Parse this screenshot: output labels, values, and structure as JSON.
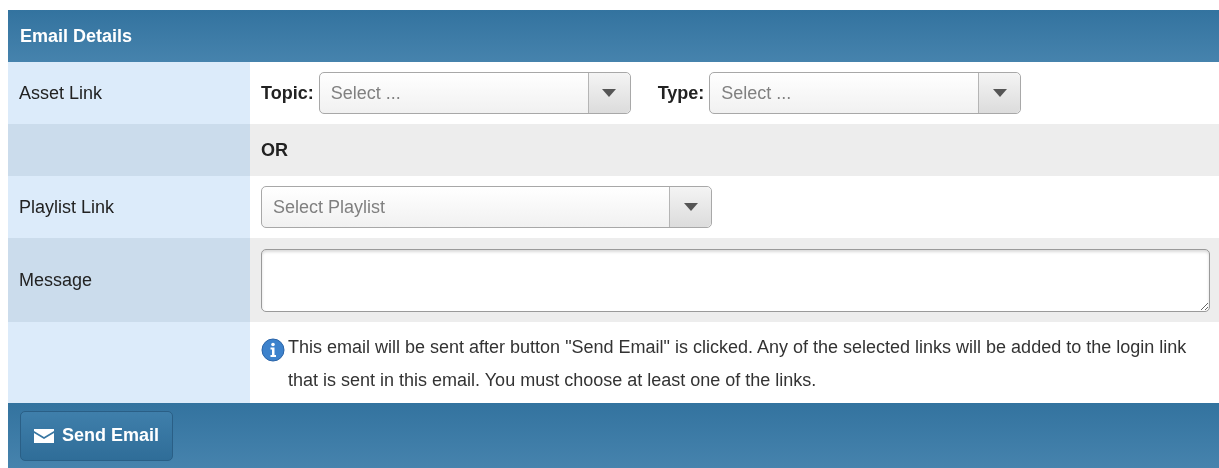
{
  "panel": {
    "title": "Email Details"
  },
  "rows": [
    {
      "kind": "selects",
      "label": "Asset Link",
      "selects": [
        {
          "label": "Topic:",
          "placeholder": "Select ..."
        },
        {
          "label": "Type:",
          "placeholder": "Select ..."
        }
      ]
    },
    {
      "kind": "separator",
      "text": "OR"
    },
    {
      "kind": "select",
      "label": "Playlist Link",
      "placeholder": "Select Playlist"
    },
    {
      "kind": "textarea",
      "label": "Message"
    },
    {
      "kind": "info",
      "text": "This email will be sent after button \"Send Email\" is clicked. Any of the selected links will be added to the login link that is sent in this email. You must choose at least one of the links."
    }
  ],
  "footer": {
    "button": "Send Email"
  }
}
